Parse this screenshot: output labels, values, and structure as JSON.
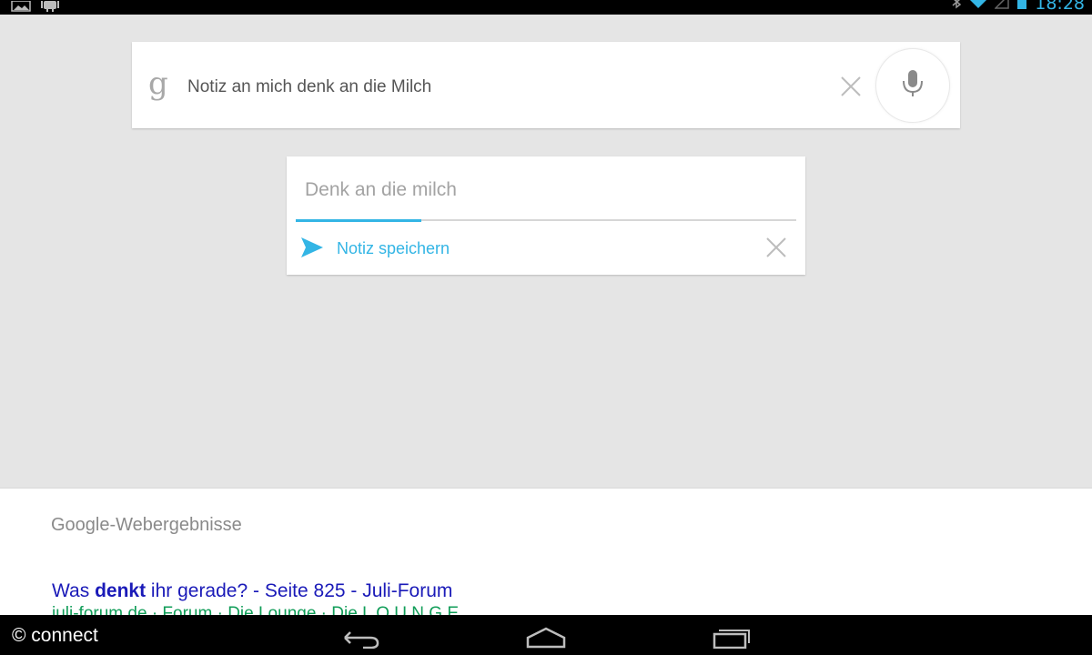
{
  "status_bar": {
    "time": "18:28",
    "icons": [
      "gallery-icon",
      "android-icon",
      "bluetooth-icon",
      "wifi-icon",
      "signal-icon",
      "battery-icon"
    ],
    "accent_color": "#33b5e5"
  },
  "search": {
    "logo": "g",
    "query": "Notiz an mich denk an die Milch",
    "clear_icon": "close-icon",
    "mic_icon": "microphone-icon"
  },
  "note": {
    "text": "Denk an die milch",
    "save_label": "Notiz speichern",
    "send_icon": "send-icon",
    "close_icon": "close-icon",
    "progress": 0.25
  },
  "results": {
    "heading": "Google-Webergebnisse",
    "items": [
      {
        "title_before": "Was ",
        "title_bold": "denkt",
        "title_after": " ihr gerade? - Seite 825 - Juli-Forum",
        "url": "juli-forum.de · Forum · Die Lounge · Die L O U N G E"
      }
    ]
  },
  "watermark": "© connect",
  "nav": {
    "back_icon": "back-icon",
    "home_icon": "home-icon",
    "recents_icon": "recent-apps-icon"
  }
}
